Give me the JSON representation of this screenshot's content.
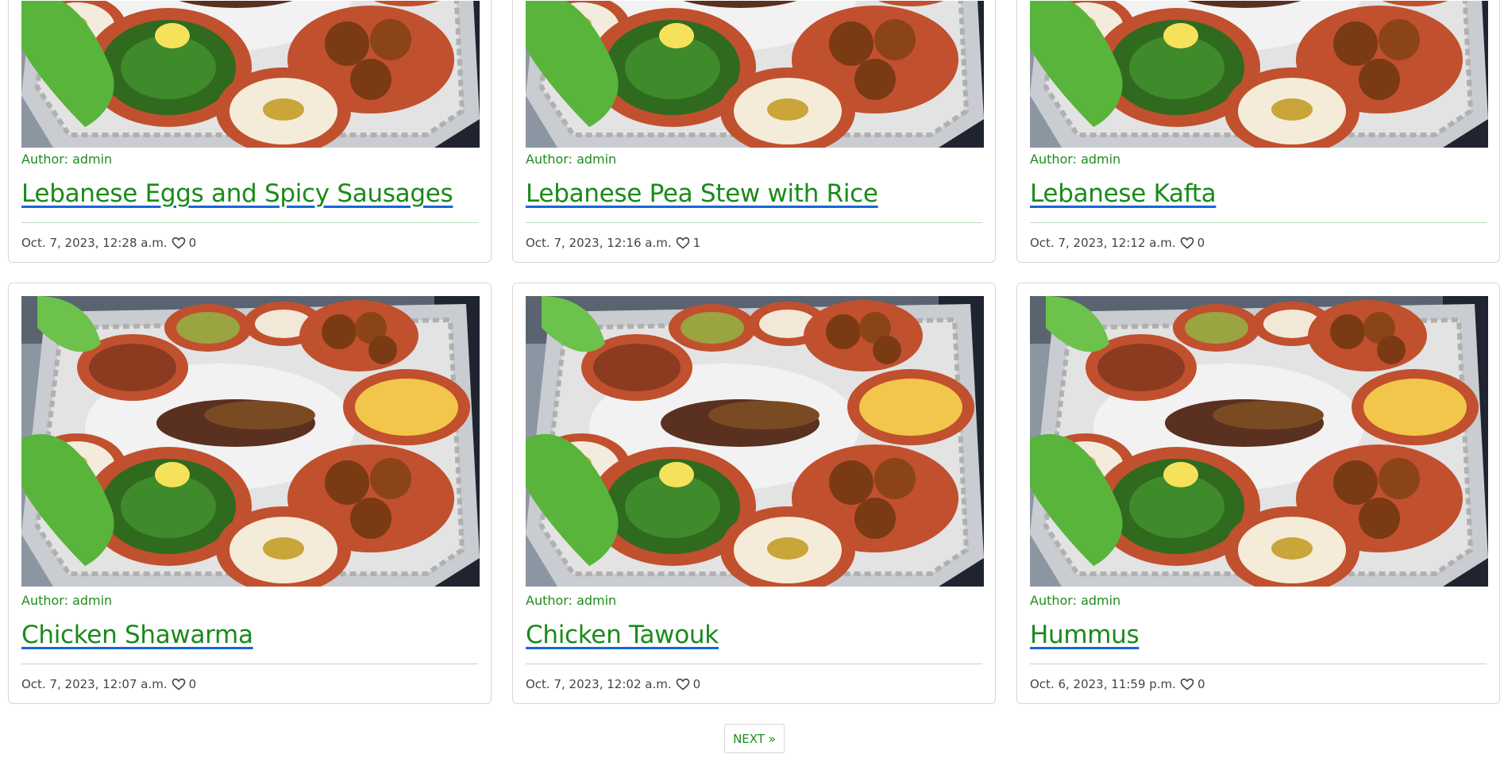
{
  "posts": [
    {
      "author": "Author: admin",
      "title": "Lebanese Eggs and Spicy Sausages",
      "date": "Oct. 7, 2023, 12:28 a.m.",
      "likes": "0"
    },
    {
      "author": "Author: admin",
      "title": "Lebanese Pea Stew with Rice",
      "date": "Oct. 7, 2023, 12:16 a.m.",
      "likes": "1"
    },
    {
      "author": "Author: admin",
      "title": "Lebanese Kafta",
      "date": "Oct. 7, 2023, 12:12 a.m.",
      "likes": "0"
    },
    {
      "author": "Author: admin",
      "title": "Chicken Shawarma",
      "date": "Oct. 7, 2023, 12:07 a.m.",
      "likes": "0"
    },
    {
      "author": "Author: admin",
      "title": "Chicken Tawouk",
      "date": "Oct. 7, 2023, 12:02 a.m.",
      "likes": "0"
    },
    {
      "author": "Author: admin",
      "title": "Hummus",
      "date": "Oct. 6, 2023, 11:59 p.m.",
      "likes": "0"
    }
  ],
  "pagination": {
    "next_label": "NEXT »"
  },
  "icons": {
    "like": "heart-icon",
    "image": "mezze-platter-photo"
  },
  "colors": {
    "link": "#1a8a1a",
    "underline": "#1a66d6",
    "author": "#1e8c1e"
  }
}
